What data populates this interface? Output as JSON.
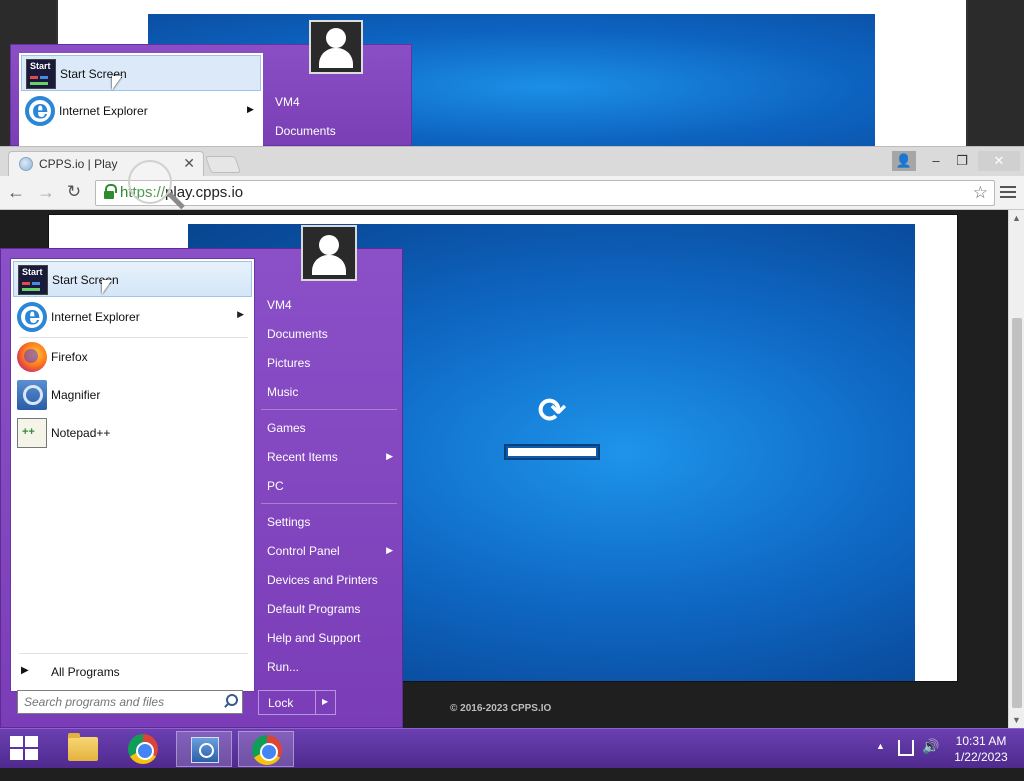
{
  "ghost": {
    "start_screen": "Start Screen",
    "internet_explorer": "Internet Explorer",
    "vm4": "VM4",
    "documents": "Documents"
  },
  "browser": {
    "tab_title": "CPPS.io | Play",
    "tab_close": "✕",
    "url_scheme": "https://",
    "url_host": "play.cpps.io",
    "back": "←",
    "forward": "→",
    "reload": "↻",
    "star": "☆",
    "win_min": "–",
    "win_max": "❐",
    "win_close": "✕"
  },
  "page": {
    "spinner": "⟳",
    "progress_fraction": 1.0,
    "copyright": "© 2016-2023 CPPS.IO"
  },
  "start_menu": {
    "left_items": [
      {
        "label": "Start Screen",
        "icon": "start-screen-icon"
      },
      {
        "label": "Internet Explorer",
        "icon": "internet-explorer-icon",
        "arrow": "▶"
      },
      {
        "label": "Firefox",
        "icon": "firefox-icon"
      },
      {
        "label": "Magnifier",
        "icon": "magnifier-icon"
      },
      {
        "label": "Notepad++",
        "icon": "notepad-plus-plus-icon"
      }
    ],
    "start_tile_text": "Start",
    "all_programs": "All Programs",
    "all_programs_arrow": "▶",
    "search_placeholder": "Search programs and files",
    "right_items": [
      {
        "label": "VM4"
      },
      {
        "label": "Documents"
      },
      {
        "label": "Pictures"
      },
      {
        "label": "Music"
      },
      {
        "label": "Games"
      },
      {
        "label": "Recent Items",
        "arrow": "▶"
      },
      {
        "label": "PC"
      },
      {
        "label": "Settings"
      },
      {
        "label": "Control Panel",
        "arrow": "▶"
      },
      {
        "label": "Devices and Printers"
      },
      {
        "label": "Default Programs"
      },
      {
        "label": "Help and Support"
      },
      {
        "label": "Run..."
      }
    ],
    "lock_label": "Lock",
    "lock_arrow": "▶"
  },
  "taskbar": {
    "tray_arrow": "▲",
    "volume": "🔊",
    "time": "10:31 AM",
    "date": "1/22/2023"
  }
}
